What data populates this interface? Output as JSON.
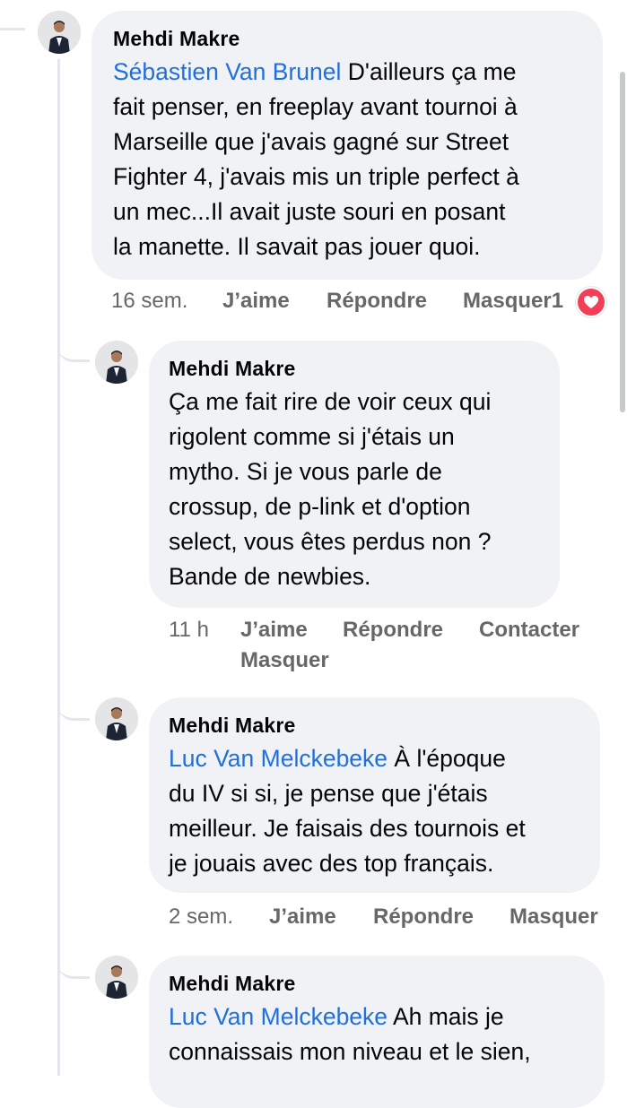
{
  "comments": [
    {
      "author": "Mehdi Makre",
      "mention": "Sébastien Van Brunel",
      "text_lines": [
        "D'ailleurs ça me",
        "fait penser, en freeplay avant  tournoi à",
        "Marseille que j'avais gagné sur Street",
        "Fighter 4, j'avais mis un triple perfect à",
        "un mec...Il avait juste souri en posant",
        "la manette. Il savait pas jouer quoi."
      ],
      "time": "16 sem.",
      "like_label": "J’aime",
      "reply_label": "Répondre",
      "hide_label": "Masquer",
      "reaction_count": "1",
      "reaction_icon": "love-reaction-icon",
      "reaction_color": "#f33e58"
    },
    {
      "author": "Mehdi Makre",
      "mention": "",
      "text_lines": [
        "Ça me fait rire de voir ceux qui",
        "rigolent comme si j'étais un",
        "mytho. Si je vous parle de",
        "crossup, de p-link et d'option",
        "select, vous êtes perdus non ?",
        "Bande de newbies."
      ],
      "time": "11 h",
      "like_label": "J’aime",
      "reply_label": "Répondre",
      "contact_label": "Contacter",
      "hide_label": "Masquer"
    },
    {
      "author": "Mehdi Makre",
      "mention": "Luc Van Melckebeke",
      "text_lines": [
        "À l'époque",
        "du IV si si, je pense que j'étais",
        "meilleur. Je faisais des tournois et",
        "je jouais avec des top français."
      ],
      "time": "2 sem.",
      "like_label": "J’aime",
      "reply_label": "Répondre",
      "hide_label": "Masquer"
    },
    {
      "author": "Mehdi Makre",
      "mention": "Luc Van Melckebeke",
      "text_lines": [
        "Ah mais je",
        "connaissais mon niveau et le sien,"
      ]
    }
  ],
  "colors": {
    "mention": "#216fdb",
    "bubble": "#f0f2f5",
    "meta": "#65676b"
  }
}
